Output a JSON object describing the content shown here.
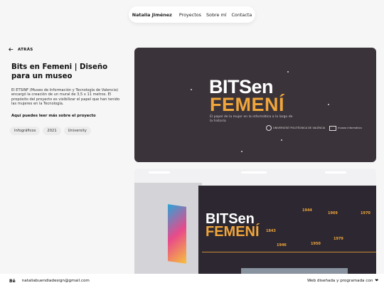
{
  "nav": {
    "brand": "Natalia Jiménez",
    "items": [
      "Proyectos",
      "Sobre mí",
      "Contacta"
    ]
  },
  "back_label": "ATRÁS",
  "project": {
    "title": "Bits en Femeni | Diseño para un museo",
    "description": "El ETSINF (Museo de Información y Tecnología de Valencia) encargó la creación de un mural de 3,5 x 11 metros. El propósito del proyecto es visibilizar el papel que han tenido las mujeres en la Tecnología.",
    "read_more": "Aquí puedes leer más sobre el proyecto",
    "tags": [
      "Infográficos",
      "2021",
      "University"
    ]
  },
  "hero": {
    "line1": "BITSen",
    "line2": "FEMENÍ",
    "subtitle": "El papel de la mujer en la informática a lo largo de la historia",
    "logo1": "UNIVERSITAT POLITÈCNICA DE VALÈNCIA",
    "logo2": "museo informática"
  },
  "photo": {
    "line1": "BITSen",
    "line2": "FEMENÍ",
    "years": [
      "1944",
      "1969",
      "1970",
      "1843",
      "1946",
      "1950",
      "1979"
    ]
  },
  "footer": {
    "behance": "Bē",
    "email": "nataliabuendiadesign@gmail.com",
    "credit": "Web diseñada y programada con",
    "heart": "❤"
  },
  "colors": {
    "accent": "#f0a63a",
    "hero_bg": "#3a3339"
  }
}
